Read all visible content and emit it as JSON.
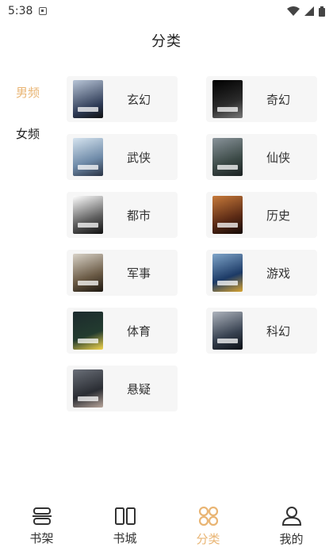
{
  "status_bar": {
    "time": "5:38"
  },
  "header": {
    "title": "分类"
  },
  "side_tabs": [
    {
      "label": "男频",
      "active": true
    },
    {
      "label": "女频",
      "active": false
    }
  ],
  "categories": [
    {
      "label": "玄幻"
    },
    {
      "label": "奇幻"
    },
    {
      "label": "武侠"
    },
    {
      "label": "仙侠"
    },
    {
      "label": "都市"
    },
    {
      "label": "历史"
    },
    {
      "label": "军事"
    },
    {
      "label": "游戏"
    },
    {
      "label": "体育"
    },
    {
      "label": "科幻"
    },
    {
      "label": "悬疑"
    }
  ],
  "bottom_nav": [
    {
      "label": "书架",
      "icon": "bookshelf-icon",
      "active": false
    },
    {
      "label": "书城",
      "icon": "bookstore-icon",
      "active": false
    },
    {
      "label": "分类",
      "icon": "category-icon",
      "active": true
    },
    {
      "label": "我的",
      "icon": "profile-icon",
      "active": false
    }
  ],
  "colors": {
    "accent": "#e9b574",
    "card_bg": "#f6f6f6",
    "text": "#333333"
  }
}
